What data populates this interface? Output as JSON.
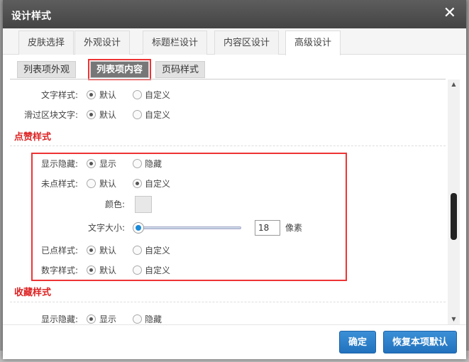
{
  "dialog": {
    "title": "设计样式",
    "close_glyph": "✕"
  },
  "tabs": [
    {
      "label": "皮肤选择",
      "active": false
    },
    {
      "label": "外观设计",
      "active": false
    },
    {
      "label": "标题栏设计",
      "active": false
    },
    {
      "label": "内容区设计",
      "active": false
    },
    {
      "label": "高级设计",
      "active": true
    }
  ],
  "subtabs": [
    {
      "label": "列表项外观",
      "active": false
    },
    {
      "label": "列表项内容",
      "active": true
    },
    {
      "label": "页码样式",
      "active": false
    }
  ],
  "list_content": {
    "text_style": {
      "label": "文字样式:",
      "options": [
        "默认",
        "自定义"
      ],
      "selected": "默认"
    },
    "hover_text": {
      "label": "滑过区块文字:",
      "options": [
        "默认",
        "自定义"
      ],
      "selected": "默认"
    }
  },
  "like_style": {
    "section_title": "点赞样式",
    "show_hide": {
      "label": "显示隐藏:",
      "options": [
        "显示",
        "隐藏"
      ],
      "selected": "显示"
    },
    "unclicked": {
      "label": "未点样式:",
      "options": [
        "默认",
        "自定义"
      ],
      "selected": "自定义"
    },
    "color_label": "颜色:",
    "font_size_label": "文字大小:",
    "font_size_value": "18",
    "font_size_unit": "像素",
    "clicked": {
      "label": "已点样式:",
      "options": [
        "默认",
        "自定义"
      ],
      "selected": "默认"
    },
    "number": {
      "label": "数字样式:",
      "options": [
        "默认",
        "自定义"
      ],
      "selected": "默认"
    }
  },
  "fav_style": {
    "section_title": "收藏样式",
    "show_hide": {
      "label": "显示隐藏:",
      "options": [
        "显示",
        "隐藏"
      ],
      "selected": "显示"
    }
  },
  "footer": {
    "confirm_label": "确定",
    "reset_label": "恢复本项默认"
  },
  "colors": {
    "accent_red": "#dd2222",
    "primary_button": "#2a7fcb",
    "titlebar": "#4f4f4f"
  }
}
